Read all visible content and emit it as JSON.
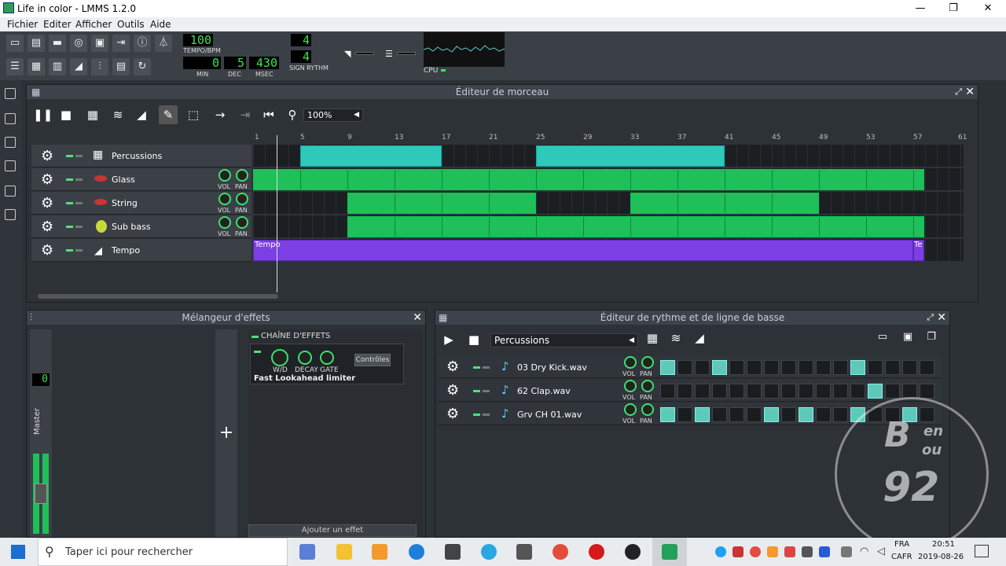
{
  "window": {
    "title": "Life in color - LMMS 1.2.0",
    "minimize": "—",
    "maximize": "❐",
    "close": "✕"
  },
  "menu": [
    "Fichier",
    "Editer",
    "Afficher",
    "Outils",
    "Aide"
  ],
  "transport": {
    "tempo": "100",
    "tempo_label": "TEMPO/BPM",
    "min": "0",
    "min_label": "MIN",
    "dec": "5",
    "dec_label": "DEC",
    "msec": "430",
    "msec_label": "MSEC",
    "sig_num": "4",
    "sig_den": "4",
    "sig_label": "SIGN RYTHM",
    "cpu_label": "CPU"
  },
  "song_editor": {
    "title": "Éditeur de morceau",
    "zoom": "100%",
    "ruler": [
      "1",
      "5",
      "9",
      "13",
      "17",
      "21",
      "25",
      "29",
      "33",
      "37",
      "41",
      "45",
      "49",
      "53",
      "57",
      "61"
    ],
    "tracks": [
      {
        "name": "Percussions",
        "kind": "beat"
      },
      {
        "name": "Glass",
        "kind": "instrument"
      },
      {
        "name": "String",
        "kind": "instrument"
      },
      {
        "name": "Sub bass",
        "kind": "instrument"
      },
      {
        "name": "Tempo",
        "kind": "automation"
      }
    ],
    "vol_label": "VOL",
    "pan_label": "PAN",
    "tempo_clip_label": "Tempo",
    "tempo_clip_label2": "Te"
  },
  "fx_mixer": {
    "title": "Mélangeur d'effets",
    "master_label": "Master",
    "master_value": "0",
    "add_channel": "+",
    "chain_title": "CHAÎNE D'EFFETS",
    "wd_label": "W/D",
    "decay_label": "DECAY",
    "gate_label": "GATE",
    "controls_button": "Contrôles",
    "effect_name": "Fast Lookahead limiter",
    "add_effect": "Ajouter un effet"
  },
  "beat_editor": {
    "title": "Éditeur de rythme et de ligne de basse",
    "pattern": "Percussions",
    "rows": [
      {
        "name": "03 Dry Kick.wav",
        "steps": [
          1,
          0,
          0,
          1,
          0,
          0,
          0,
          0,
          0,
          0,
          0,
          1,
          0,
          0,
          0,
          0
        ]
      },
      {
        "name": "62 Clap.wav",
        "steps": [
          0,
          0,
          0,
          0,
          0,
          0,
          0,
          0,
          0,
          0,
          0,
          0,
          1,
          0,
          0,
          0
        ]
      },
      {
        "name": "Grv CH 01.wav",
        "steps": [
          1,
          0,
          1,
          0,
          0,
          0,
          1,
          0,
          1,
          0,
          0,
          1,
          0,
          0,
          1,
          0
        ]
      }
    ]
  },
  "watermark": {
    "line1": "B",
    "line2": "en",
    "line3": "ou",
    "line4": "92"
  },
  "taskbar": {
    "search_placeholder": "Taper ici pour rechercher",
    "lang": "FRA",
    "lang2": "CAFR",
    "time": "20:51",
    "date": "2019-08-26"
  },
  "colors": {
    "accent_green": "#3ee06c",
    "clip_cyan": "#2ec9b8",
    "clip_green": "#1fbf5a",
    "automation": "#7b3fe4"
  }
}
